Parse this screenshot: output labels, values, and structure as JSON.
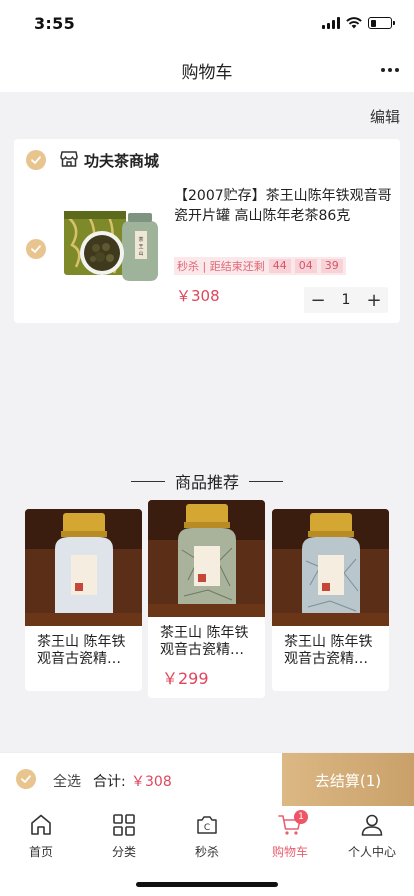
{
  "status": {
    "time": "3:55"
  },
  "nav": {
    "title": "购物车"
  },
  "edit_label": "编辑",
  "shop": {
    "name": "功夫茶商城"
  },
  "item": {
    "title": "【2007贮存】茶王山陈年铁观音哥瓷开片罐 高山陈年老茶86克",
    "seckill_label": "秒杀 | 距结束还剩",
    "countdown": [
      "44",
      "04",
      "39"
    ],
    "price": "￥308",
    "quantity": "1",
    "minus": "−",
    "plus": "+"
  },
  "recommend": {
    "title": "商品推荐",
    "products": [
      {
        "name": "茶王山 陈年铁观音古瓷精…",
        "price": ""
      },
      {
        "name": "茶王山 陈年铁观音古瓷精…",
        "price": "￥299"
      },
      {
        "name": "茶王山 陈年铁观音古瓷精…",
        "price": ""
      }
    ]
  },
  "checkout": {
    "select_all": "全选",
    "total_label": "合计:",
    "total_value": "￥308",
    "button": "去结算(1)"
  },
  "tabs": [
    {
      "label": "首页",
      "icon": "home-icon"
    },
    {
      "label": "分类",
      "icon": "grid-icon"
    },
    {
      "label": "秒杀",
      "icon": "seckill-icon"
    },
    {
      "label": "购物车",
      "icon": "cart-icon",
      "badge": "1",
      "active": true
    },
    {
      "label": "个人中心",
      "icon": "user-icon"
    }
  ],
  "colors": {
    "accent": "#e8c58f",
    "price": "#e0455c",
    "active_tab": "#e86070"
  }
}
